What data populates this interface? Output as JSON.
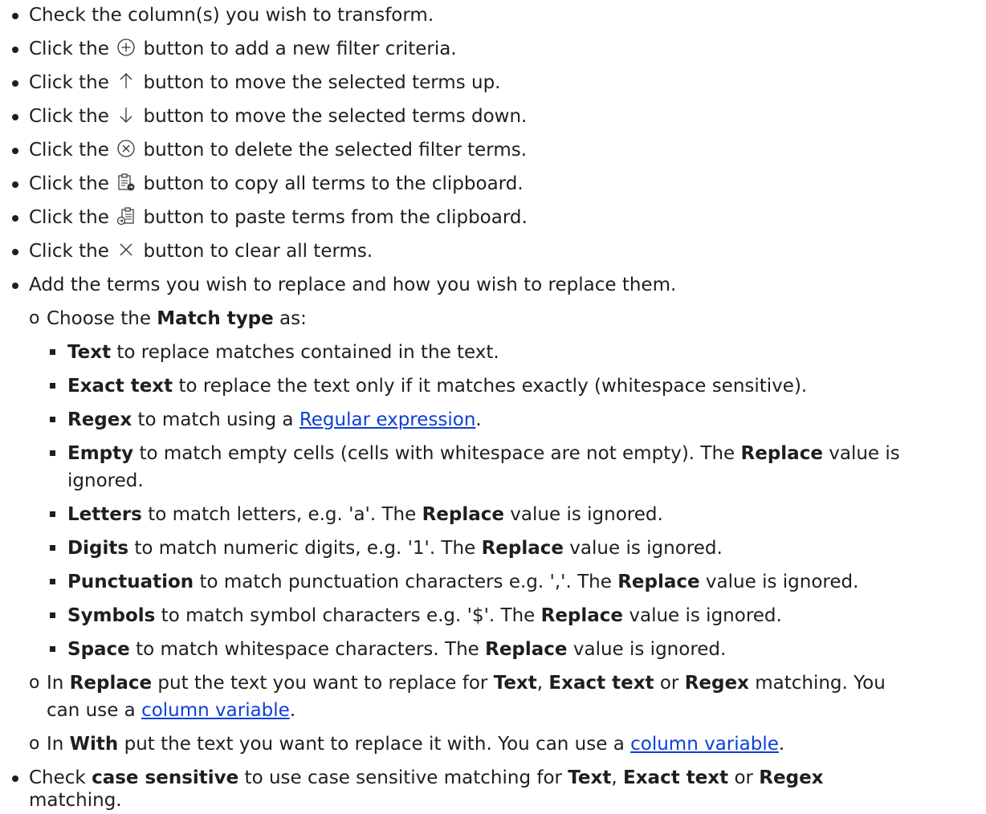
{
  "level1": [
    {
      "prefix": "Check the column(s) you wish to transform."
    },
    {
      "prefix": "Click the",
      "icon": "plus-circle-icon",
      "suffix": "button to add a new filter criteria."
    },
    {
      "prefix": "Click the",
      "icon": "arrow-up-icon",
      "suffix": "button to move the selected terms up."
    },
    {
      "prefix": "Click the",
      "icon": "arrow-down-icon",
      "suffix": "button to move the selected terms down."
    },
    {
      "prefix": "Click the",
      "icon": "x-circle-icon",
      "suffix": "button to delete the selected filter terms."
    },
    {
      "prefix": "Click the",
      "icon": "copy-clipboard-icon",
      "suffix": "button to copy all terms to the clipboard."
    },
    {
      "prefix": "Click the",
      "icon": "paste-clipboard-icon",
      "suffix": "button to paste terms from the clipboard."
    },
    {
      "prefix": "Click the",
      "icon": "clear-x-icon",
      "suffix": "button to clear all terms."
    },
    {
      "prefix": "Add the terms you wish to replace and how you wish to replace them."
    }
  ],
  "match_intro": {
    "pre": "Choose the ",
    "bold": "Match type",
    "post": " as:"
  },
  "match_types": [
    {
      "bold": "Text",
      "text": " to replace matches contained in the text."
    },
    {
      "bold": "Exact text",
      "text": " to replace the text only if it matches exactly (whitespace sensitive)."
    },
    {
      "bold": "Regex",
      "text": " to match using a ",
      "link": "Regular expression",
      "after": "."
    },
    {
      "bold": "Empty",
      "text": " to match empty cells (cells with whitespace are not empty). The ",
      "bold2": "Replace",
      "text2": " value is",
      "cont": "ignored."
    },
    {
      "bold": "Letters",
      "text": " to match letters, e.g. 'a'. The ",
      "bold2": "Replace",
      "text2": " value is ignored."
    },
    {
      "bold": "Digits",
      "text": " to match numeric digits, e.g. '1'. The ",
      "bold2": "Replace",
      "text2": " value is ignored."
    },
    {
      "bold": "Punctuation",
      "text": " to match punctuation characters e.g. ','. The ",
      "bold2": "Replace",
      "text2": " value is ignored."
    },
    {
      "bold": "Symbols",
      "text": " to match symbol characters e.g. '$'. The ",
      "bold2": "Replace",
      "text2": " value is ignored."
    },
    {
      "bold": "Space",
      "text": " to match whitespace characters. The ",
      "bold2": "Replace",
      "text2": " value is ignored."
    }
  ],
  "replace_item": {
    "pre": "In ",
    "bold": "Replace",
    "mid": " put the text you want to replace for ",
    "b1": "Text",
    "c1": ", ",
    "b2": "Exact text",
    "c2": " or ",
    "b3": "Regex",
    "post": " matching. You",
    "cont_pre": "can use a ",
    "link": "column variable",
    "cont_post": "."
  },
  "with_item": {
    "pre": "In ",
    "bold": "With",
    "mid": " put the text you want to replace it with. You can use a ",
    "link": "column variable",
    "post": "."
  },
  "case_item": {
    "pre": "Check ",
    "bold": "case sensitive",
    "mid": " to use case sensitive matching for ",
    "b1": "Text",
    "c1": ", ",
    "b2": "Exact text",
    "c2": " or ",
    "b3": "Regex",
    "cont": "matching."
  },
  "circle_bullet": "o"
}
